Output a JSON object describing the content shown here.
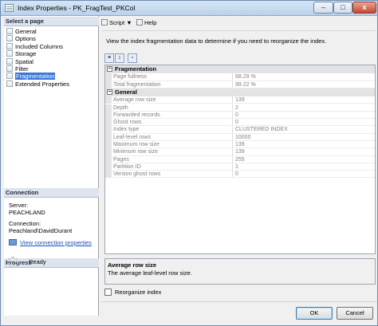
{
  "window": {
    "title": "Index Properties - PK_FragTest_PKCol",
    "min_label": "–",
    "max_label": "□",
    "close_label": "x"
  },
  "left": {
    "select_page_heading": "Select a page",
    "pages": [
      "General",
      "Options",
      "Included Columns",
      "Storage",
      "Spatial",
      "Filter",
      "Fragmentation",
      "Extended Properties"
    ],
    "selected_page": "Fragmentation",
    "connection_heading": "Connection",
    "server_label": "Server:",
    "server_value": "PEACHLAND",
    "connection_label": "Connection:",
    "connection_value": "Peachland\\DavidDurant",
    "view_connection_link": "View connection properties",
    "progress_heading": "Progress",
    "progress_status": "Ready"
  },
  "toolbar": {
    "script_label": "Script",
    "script_arrow": "▼",
    "help_label": "Help"
  },
  "main": {
    "description": "View the index fragmentation data to determine if you need to reorganize the index.",
    "grid": {
      "categories": [
        {
          "name": "Fragmentation",
          "toggle": "−",
          "rows": [
            {
              "name": "Page fullness",
              "value": "68.29 %"
            },
            {
              "name": "Total fragmentation",
              "value": "99.22 %"
            }
          ]
        },
        {
          "name": "General",
          "toggle": "−",
          "rows": [
            {
              "name": "Average row size",
              "value": "139"
            },
            {
              "name": "Depth",
              "value": "2"
            },
            {
              "name": "Forwarded records",
              "value": "0"
            },
            {
              "name": "Ghost rows",
              "value": "0"
            },
            {
              "name": "Index type",
              "value": "CLUSTERED INDEX"
            },
            {
              "name": "Leaf-level rows",
              "value": "10000"
            },
            {
              "name": "Maximum row size",
              "value": "139"
            },
            {
              "name": "Minimum row size",
              "value": "139"
            },
            {
              "name": "Pages",
              "value": "255"
            },
            {
              "name": "Partition ID",
              "value": "1"
            },
            {
              "name": "Version ghost rows",
              "value": "0"
            }
          ]
        }
      ]
    },
    "help_title": "Average row size",
    "help_text": "The average leaf-level row size.",
    "reorganize_label": "Reorganize index",
    "reorganize_checked": false
  },
  "buttons": {
    "ok": "OK",
    "cancel": "Cancel"
  }
}
